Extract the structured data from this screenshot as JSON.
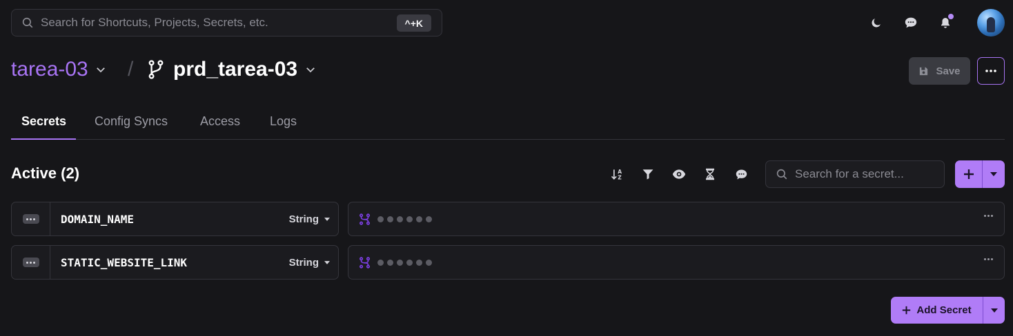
{
  "search": {
    "placeholder": "Search for Shortcuts, Projects, Secrets, etc.",
    "shortcut": "^+K"
  },
  "header": {
    "project": "tarea-03",
    "separator": "/",
    "environment": "prd_tarea-03",
    "save_label": "Save"
  },
  "tabs": [
    {
      "label": "Secrets",
      "active": true
    },
    {
      "label": "Config Syncs",
      "active": false
    },
    {
      "label": "Access",
      "active": false
    },
    {
      "label": "Logs",
      "active": false
    }
  ],
  "section": {
    "title": "Active (2)"
  },
  "secret_search": {
    "placeholder": "Search for a secret..."
  },
  "secrets": [
    {
      "key": "DOMAIN_NAME",
      "type": "String",
      "value_masked": "●●●●●●"
    },
    {
      "key": "STATIC_WEBSITE_LINK",
      "type": "String",
      "value_masked": "●●●●●●"
    }
  ],
  "add_secret_label": "Add Secret",
  "colors": {
    "accent": "#a874f4",
    "button_purple": "#b07cf7",
    "background": "#161619"
  }
}
